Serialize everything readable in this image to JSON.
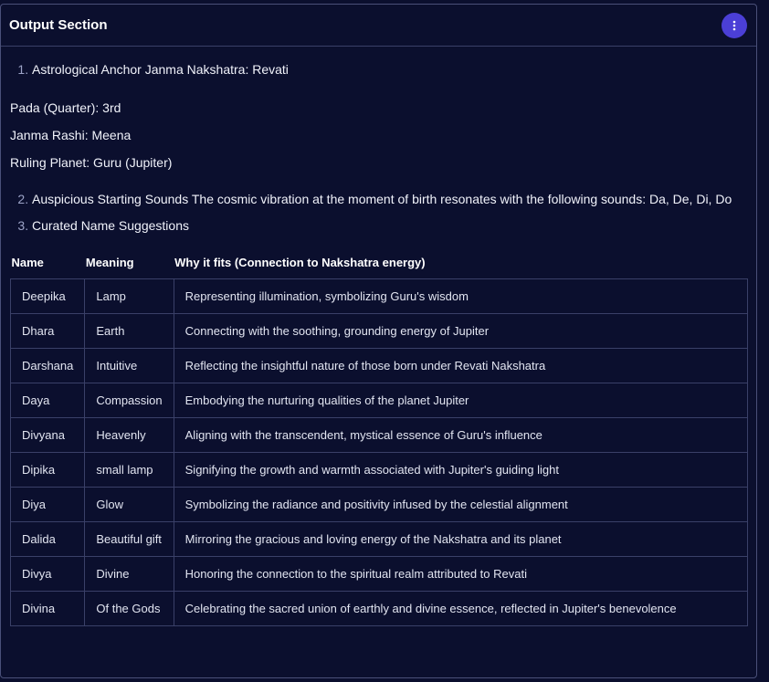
{
  "panel": {
    "title": "Output Section",
    "menu_icon": "more-vertical-icon"
  },
  "sections": {
    "item1": "Astrological Anchor Janma Nakshatra: Revati",
    "pada": "Pada (Quarter): 3rd",
    "rashi": "Janma Rashi: Meena",
    "planet": "Ruling Planet: Guru (Jupiter)",
    "item2": "Auspicious Starting Sounds The cosmic vibration at the moment of birth resonates with the following sounds: Da, De, Di, Do",
    "item3": "Curated Name Suggestions"
  },
  "table": {
    "headers": [
      "Name",
      "Meaning",
      "Why it fits (Connection to Nakshatra energy)"
    ],
    "rows": [
      [
        "Deepika",
        "Lamp",
        "Representing illumination, symbolizing Guru's wisdom"
      ],
      [
        "Dhara",
        "Earth",
        "Connecting with the soothing, grounding energy of Jupiter"
      ],
      [
        "Darshana",
        "Intuitive",
        "Reflecting the insightful nature of those born under Revati Nakshatra"
      ],
      [
        "Daya",
        "Compassion",
        "Embodying the nurturing qualities of the planet Jupiter"
      ],
      [
        "Divyana",
        "Heavenly",
        "Aligning with the transcendent, mystical essence of Guru's influence"
      ],
      [
        "Dipika",
        "small lamp",
        "Signifying the growth and warmth associated with Jupiter's guiding light"
      ],
      [
        "Diya",
        "Glow",
        "Symbolizing the radiance and positivity infused by the celestial alignment"
      ],
      [
        "Dalida",
        "Beautiful gift",
        "Mirroring the gracious and loving energy of the Nakshatra and its planet"
      ],
      [
        "Divya",
        "Divine",
        "Honoring the connection to the spiritual realm attributed to Revati"
      ],
      [
        "Divina",
        "Of the Gods",
        "Celebrating the sacred union of earthly and divine essence, reflected in Jupiter's benevolence"
      ]
    ]
  },
  "colors": {
    "background": "#0b0f2e",
    "accent": "#4b3fd6",
    "border": "#3a4068"
  }
}
